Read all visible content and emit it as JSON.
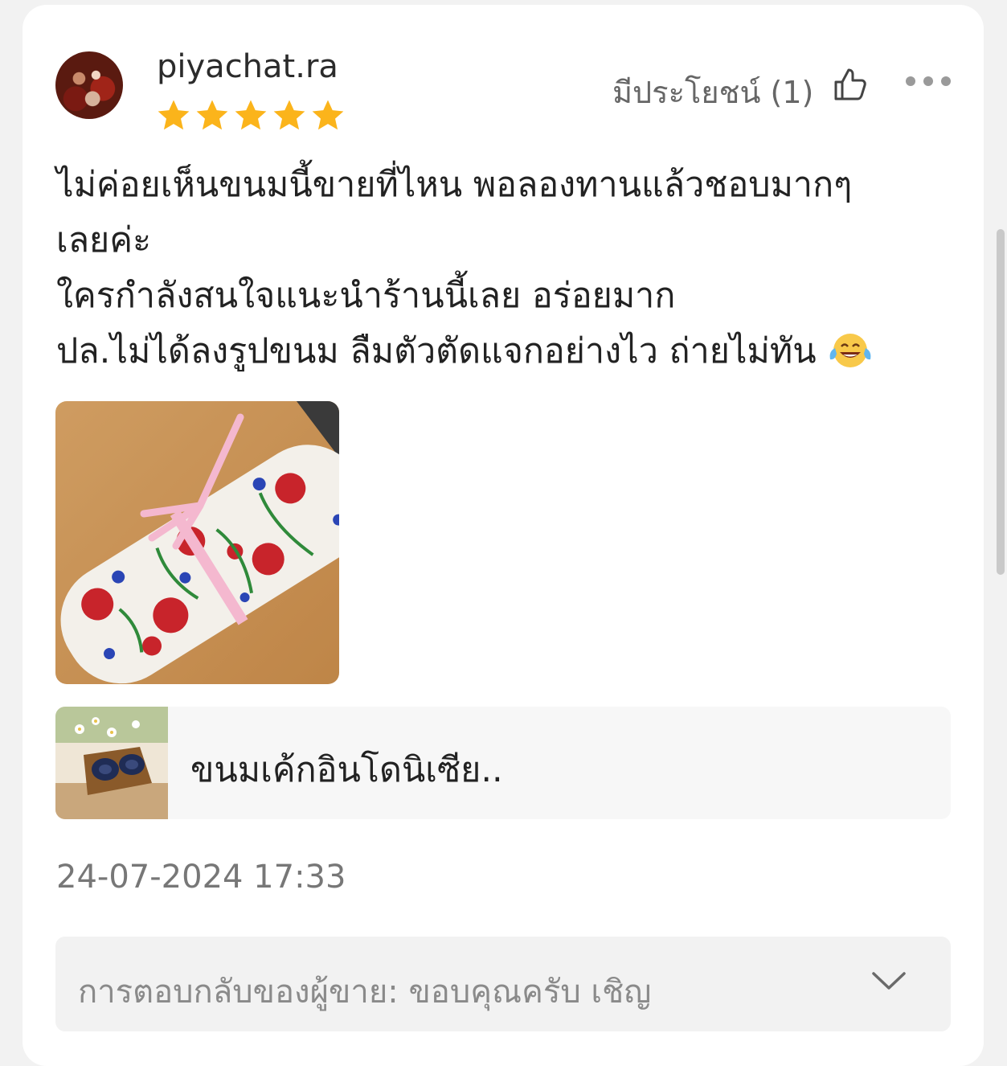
{
  "review": {
    "username": "piyachat.ra",
    "rating": 5,
    "rating_max": 5,
    "helpful_label": "มีประโยชน์ (1)",
    "lines": [
      "ไม่ค่อยเห็นขนมนี้ขายที่ไหน พอลองทานแล้วชอบมากๆ",
      "เลยค่ะ",
      "ใครกำลังสนใจแนะนำร้านนี้เลย อร่อยมาก",
      "ปล.ไม่ได้ลงรูปขนม ลืมตัวตัดแจกอย่างไว ถ่ายไม่ทัน"
    ],
    "line4_emoji": "face-with-tears-of-joy-emoji",
    "photo": "photo of a floral cloth-wrapped roll tied with pink ribbon on wooden table",
    "date": "24-07-2024 17:33"
  },
  "product": {
    "name": "ขนมเค้กอินโดนิเซีย..",
    "thumbnail": "product-thumbnail"
  },
  "seller_reply": {
    "text": "การตอบกลับของผู้ขาย: ขอบคุณครับ เชิญ"
  },
  "icons": {
    "helpful": "thumbs-up-icon",
    "more": "more-options-icon",
    "expand": "chevron-down-icon",
    "star": "star-icon"
  },
  "colors": {
    "star": "#fbb41b",
    "card_bg": "#ffffff",
    "page_bg": "#f2f2f2",
    "muted_text": "#777777"
  }
}
